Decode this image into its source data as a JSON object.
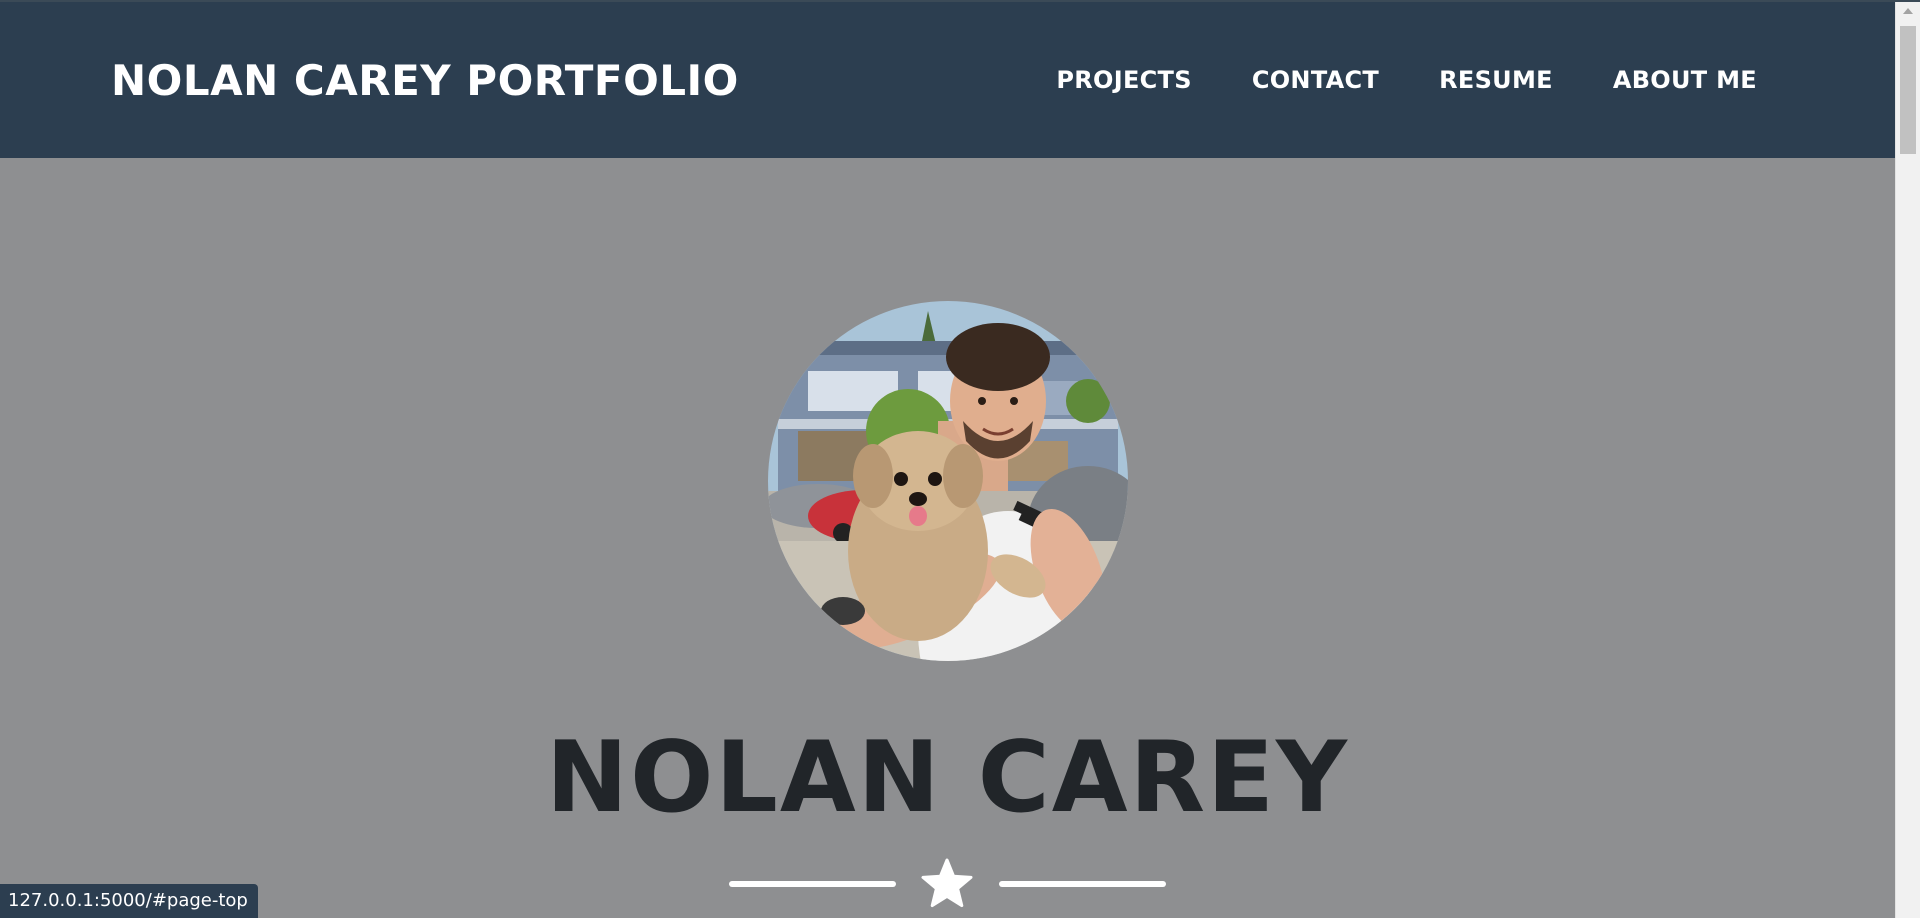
{
  "navbar": {
    "brand": "NOLAN CAREY PORTFOLIO",
    "links": [
      {
        "label": "PROJECTS"
      },
      {
        "label": "CONTACT"
      },
      {
        "label": "RESUME"
      },
      {
        "label": "ABOUT ME"
      }
    ]
  },
  "masthead": {
    "avatar_icon": "profile-photo",
    "heading": "NOLAN CAREY",
    "divider_icon": "star-icon"
  },
  "status_bar": {
    "url": "127.0.0.1:5000/#page-top"
  },
  "colors": {
    "navbar_bg": "#2c3e50",
    "page_bg": "#8e8f91",
    "heading": "#212529",
    "accent": "#ffffff"
  }
}
